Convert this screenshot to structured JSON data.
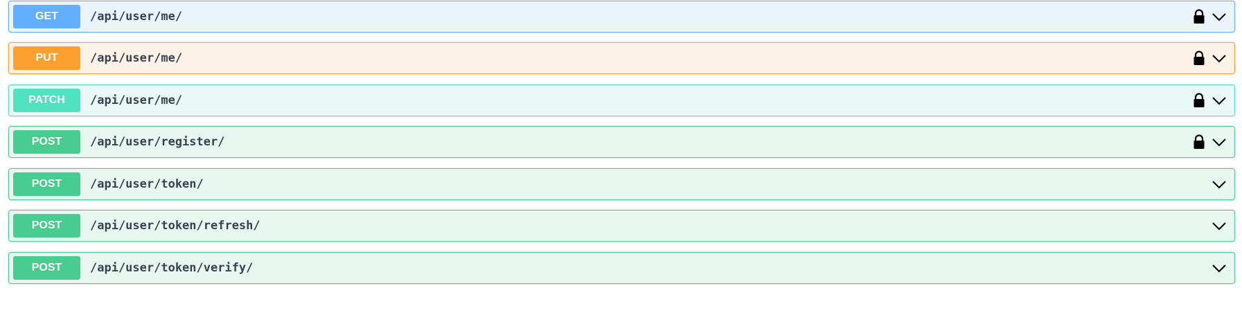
{
  "colors": {
    "get": "#61affe",
    "put": "#fca130",
    "patch": "#50e3c2",
    "post": "#49cc90",
    "path_text": "#3b4151"
  },
  "operations": [
    {
      "method": "GET",
      "path": "/api/user/me/",
      "locked": true,
      "icon_lock": "lock-icon",
      "icon_expand": "chevron-down-icon"
    },
    {
      "method": "PUT",
      "path": "/api/user/me/",
      "locked": true,
      "icon_lock": "lock-icon",
      "icon_expand": "chevron-down-icon"
    },
    {
      "method": "PATCH",
      "path": "/api/user/me/",
      "locked": true,
      "icon_lock": "lock-icon",
      "icon_expand": "chevron-down-icon"
    },
    {
      "method": "POST",
      "path": "/api/user/register/",
      "locked": true,
      "icon_lock": "lock-icon",
      "icon_expand": "chevron-down-icon"
    },
    {
      "method": "POST",
      "path": "/api/user/token/",
      "locked": false,
      "icon_expand": "chevron-down-icon"
    },
    {
      "method": "POST",
      "path": "/api/user/token/refresh/",
      "locked": false,
      "icon_expand": "chevron-down-icon"
    },
    {
      "method": "POST",
      "path": "/api/user/token/verify/",
      "locked": false,
      "icon_expand": "chevron-down-icon"
    }
  ]
}
